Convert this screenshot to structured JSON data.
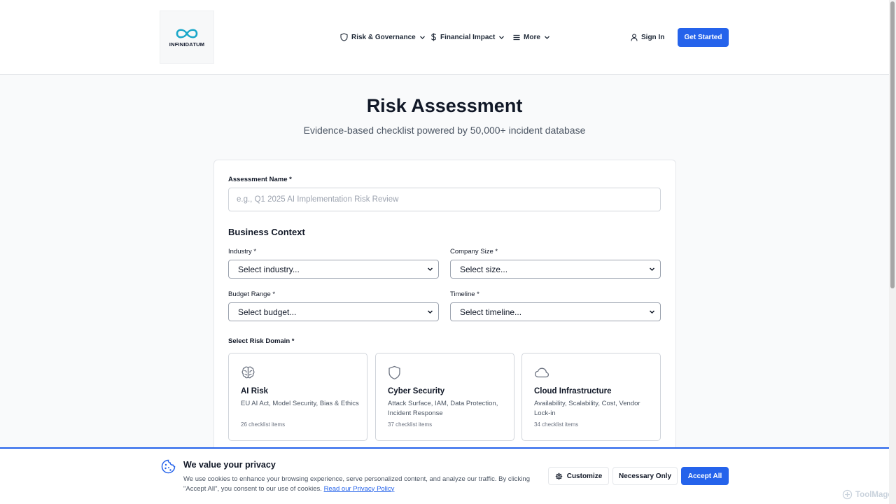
{
  "header": {
    "logo_text": "INFINIDATUM",
    "nav": {
      "risk": "Risk & Governance",
      "financial": "Financial Impact",
      "more": "More"
    },
    "sign_in": "Sign In",
    "get_started": "Get Started"
  },
  "hero": {
    "title": "Risk Assessment",
    "subtitle": "Evidence-based checklist powered by 50,000+ incident database"
  },
  "form": {
    "assessment_name_label": "Assessment Name *",
    "assessment_name_placeholder": "e.g., Q1 2025 AI Implementation Risk Review",
    "business_context": "Business Context",
    "industry_label": "Industry *",
    "industry_value": "Select industry...",
    "company_size_label": "Company Size *",
    "company_size_value": "Select size...",
    "budget_label": "Budget Range *",
    "budget_value": "Select budget...",
    "timeline_label": "Timeline *",
    "timeline_value": "Select timeline...",
    "domain_label": "Select Risk Domain *",
    "domains": [
      {
        "icon": "brain-icon",
        "title": "AI Risk",
        "desc": "EU AI Act, Model Security, Bias & Ethics",
        "count": "26 checklist items"
      },
      {
        "icon": "shield-icon",
        "title": "Cyber Security",
        "desc": "Attack Surface, IAM, Data Protection, Incident Response",
        "count": "37 checklist items"
      },
      {
        "icon": "cloud-icon",
        "title": "Cloud Infrastructure",
        "desc": "Availability, Scalability, Cost, Vendor Lock-in",
        "count": "34 checklist items"
      }
    ]
  },
  "cookie": {
    "title": "We value your privacy",
    "text": "We use cookies to enhance your browsing experience, serve personalized content, and analyze our traffic. By clicking \"Accept All\", you consent to our use of cookies.",
    "link": "Read our Privacy Policy",
    "customize": "Customize",
    "necessary": "Necessary Only",
    "accept": "Accept All"
  },
  "watermark": "ToolMage",
  "colors": {
    "accent": "#2563eb",
    "text": "#111827",
    "muted": "#4b5563"
  }
}
